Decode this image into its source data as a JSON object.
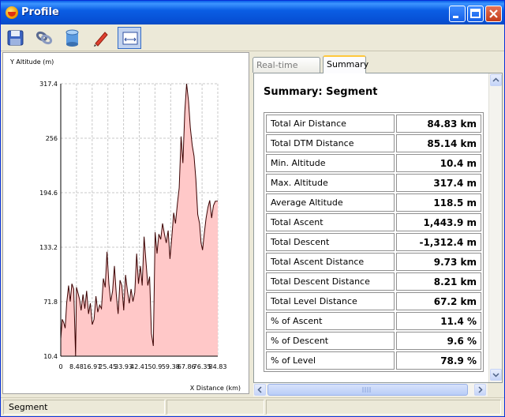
{
  "window": {
    "title": "Profile"
  },
  "toolbar": {
    "tools": [
      {
        "name": "save",
        "icon": "floppy-disk-icon"
      },
      {
        "name": "link",
        "icon": "chain-link-icon"
      },
      {
        "name": "database",
        "icon": "database-icon"
      },
      {
        "name": "measure",
        "icon": "pencil-ruler-icon"
      },
      {
        "name": "profile",
        "icon": "profile-view-icon",
        "active": true
      }
    ]
  },
  "tabs": [
    {
      "label": "Real-time Profile",
      "selected": false
    },
    {
      "label": "Summary",
      "selected": true
    }
  ],
  "summary": {
    "title": "Summary: Segment",
    "rows": [
      {
        "label": "Total Air Distance",
        "value": "84.83 km"
      },
      {
        "label": "Total DTM Distance",
        "value": "85.14 km"
      },
      {
        "label": "Min. Altitude",
        "value": "10.4 m"
      },
      {
        "label": "Max. Altitude",
        "value": "317.4 m"
      },
      {
        "label": "Average Altitude",
        "value": "118.5 m"
      },
      {
        "label": "Total Ascent",
        "value": "1,443.9 m"
      },
      {
        "label": "Total Descent",
        "value": "-1,312.4 m"
      },
      {
        "label": "Total Ascent Distance",
        "value": "9.73 km"
      },
      {
        "label": "Total Descent Distance",
        "value": "8.21 km"
      },
      {
        "label": "Total Level Distance",
        "value": "67.2 km"
      },
      {
        "label": "% of Ascent",
        "value": "11.4 %"
      },
      {
        "label": "% of Descent",
        "value": "9.6 %"
      },
      {
        "label": "% of Level",
        "value": "78.9 %"
      }
    ]
  },
  "status": {
    "text": "Segment"
  },
  "chart_data": {
    "type": "area",
    "ylabel": "Y Altitude (m)",
    "xlabel": "X Distance (km)",
    "ylim": [
      10.4,
      317.4
    ],
    "xlim": [
      0,
      84.83
    ],
    "yticks": [
      "10.4",
      "71.8",
      "133.2",
      "194.6",
      "256",
      "317.4"
    ],
    "xticks": [
      "0",
      "8.48",
      "16.97",
      "25.45",
      "33.93",
      "42.41",
      "50.9",
      "59.38",
      "67.86",
      "76.35",
      "84.83"
    ],
    "grid": true,
    "fill_color": "#ffc8c8",
    "line_color": "#3a0000",
    "x": [
      0,
      0.8,
      1.6,
      2.4,
      3.2,
      4.2,
      5.1,
      6.0,
      7.0,
      8.0,
      8.5,
      9.5,
      10.2,
      11.0,
      12.0,
      13.0,
      14.0,
      15.0,
      16.0,
      17.0,
      18.0,
      19.0,
      20.0,
      21.0,
      22.0,
      23.0,
      24.0,
      25.0,
      26.0,
      27.0,
      28.0,
      29.0,
      30.0,
      31.0,
      32.0,
      33.0,
      34.0,
      35.0,
      36.0,
      37.0,
      38.0,
      39.0,
      40.0,
      41.0,
      42.0,
      43.0,
      44.0,
      45.0,
      46.0,
      47.0,
      48.0,
      49.0,
      50.0,
      51.0,
      52.0,
      53.0,
      54.0,
      55.0,
      56.0,
      57.0,
      58.0,
      59.0,
      60.0,
      61.0,
      62.0,
      63.0,
      64.0,
      65.0,
      66.0,
      67.0,
      68.0,
      69.0,
      70.0,
      71.0,
      72.0,
      73.0,
      74.0,
      75.0,
      75.8,
      76.6,
      77.5,
      78.5,
      79.5,
      80.5,
      81.5,
      82.5,
      83.5,
      84.83
    ],
    "y": [
      30,
      52,
      48,
      42,
      70,
      90,
      72,
      92,
      86,
      10.4,
      88,
      80,
      74,
      62,
      80,
      64,
      84,
      58,
      70,
      46,
      52,
      78,
      60,
      68,
      64,
      98,
      88,
      128,
      92,
      72,
      84,
      112,
      80,
      58,
      96,
      90,
      62,
      102,
      84,
      70,
      86,
      72,
      82,
      126,
      92,
      112,
      90,
      145,
      118,
      90,
      100,
      36,
      22,
      150,
      126,
      148,
      142,
      160,
      148,
      138,
      152,
      120,
      145,
      172,
      160,
      182,
      200,
      258,
      228,
      286,
      317.4,
      298,
      268,
      248,
      236,
      210,
      170,
      160,
      138,
      130,
      148,
      166,
      178,
      186,
      166,
      180,
      185,
      185
    ]
  }
}
